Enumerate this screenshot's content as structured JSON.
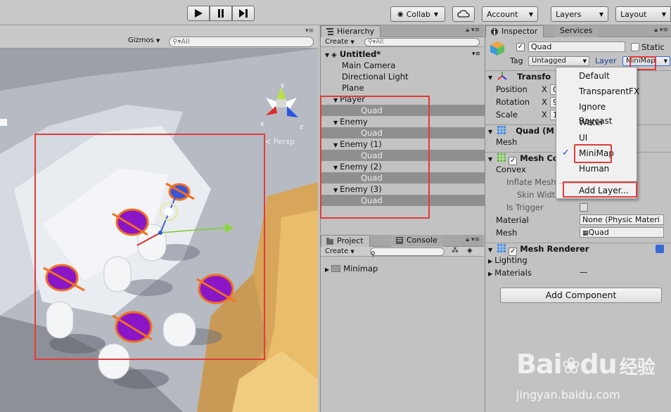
{
  "toolbar": {
    "collab_label": "Collab",
    "account_label": "Account",
    "layers_label": "Layers",
    "layout_label": "Layout"
  },
  "scene": {
    "gizmos_label": "Gizmos",
    "search_placeholder": "All",
    "persp_label": "Persp",
    "axis_x": "x",
    "axis_y": "y",
    "axis_z": "z"
  },
  "hierarchy": {
    "tab_label": "Hierarchy",
    "create_label": "Create",
    "search_placeholder": "All",
    "scene_name": "Untitled*",
    "rows": [
      {
        "label": "Main Camera",
        "depth": 1,
        "selected": false,
        "expandable": false
      },
      {
        "label": "Directional Light",
        "depth": 1,
        "selected": false,
        "expandable": false
      },
      {
        "label": "Plane",
        "depth": 1,
        "selected": false,
        "expandable": false
      },
      {
        "label": "Player",
        "depth": 1,
        "selected": false,
        "expandable": true
      },
      {
        "label": "Quad",
        "depth": 2,
        "selected": true,
        "expandable": false
      },
      {
        "label": "Enemy",
        "depth": 1,
        "selected": false,
        "expandable": true
      },
      {
        "label": "Quad",
        "depth": 2,
        "selected": true,
        "expandable": false
      },
      {
        "label": "Enemy (1)",
        "depth": 1,
        "selected": false,
        "expandable": true
      },
      {
        "label": "Quad",
        "depth": 2,
        "selected": true,
        "expandable": false
      },
      {
        "label": "Enemy (2)",
        "depth": 1,
        "selected": false,
        "expandable": true
      },
      {
        "label": "Quad",
        "depth": 2,
        "selected": true,
        "expandable": false
      },
      {
        "label": "Enemy (3)",
        "depth": 1,
        "selected": false,
        "expandable": true
      },
      {
        "label": "Quad",
        "depth": 2,
        "selected": true,
        "expandable": false
      }
    ]
  },
  "project": {
    "tab_label": "Project",
    "console_tab_label": "Console",
    "create_label": "Create",
    "folder_label": "Minimap"
  },
  "inspector": {
    "tab_label": "Inspector",
    "services_tab_label": "Services",
    "object_name": "Quad",
    "static_label": "Static",
    "tag_label": "Tag",
    "tag_value": "Untagged",
    "layer_label": "Layer",
    "layer_value": "MiniMap",
    "transform_title": "Transfo",
    "position_label": "Position",
    "rotation_label": "Rotation",
    "scale_label": "Scale",
    "x_label": "X",
    "position_x": "0",
    "rotation_x": "9",
    "scale_x": "1",
    "mesh_filter_title": "Quad (M",
    "mesh_label": "Mesh",
    "mesh_collider_title": "Mesh Co",
    "convex_label": "Convex",
    "inflate_label": "Inflate Mesh",
    "skin_label": "Skin Widt",
    "trigger_label": "Is Trigger",
    "material_label": "Material",
    "material_value": "None (Physic Materi",
    "mesh2_label": "Mesh",
    "mesh2_value": "Quad",
    "renderer_title": "Mesh Renderer",
    "lighting_label": "Lighting",
    "materials_label": "Materials",
    "materials_dash": "—",
    "add_component_label": "Add Component"
  },
  "layer_menu": {
    "items": [
      {
        "label": "Default",
        "checked": false
      },
      {
        "label": "TransparentFX",
        "checked": false
      },
      {
        "label": "Ignore Raycast",
        "checked": false
      },
      {
        "label": "Water",
        "checked": false
      },
      {
        "label": "UI",
        "checked": false
      },
      {
        "label": "MiniMap",
        "checked": true
      },
      {
        "label": "Human",
        "checked": false
      }
    ],
    "add_layer_label": "Add Layer..."
  },
  "watermark": {
    "text_left": "Bai",
    "text_right": "du",
    "text_cn": "经验",
    "url": "jingyan.baidu.com"
  },
  "colors": {
    "highlight_red": "#e03c3c",
    "selected_row": "#8f8f8f",
    "check_blue": "#1b46b8"
  }
}
